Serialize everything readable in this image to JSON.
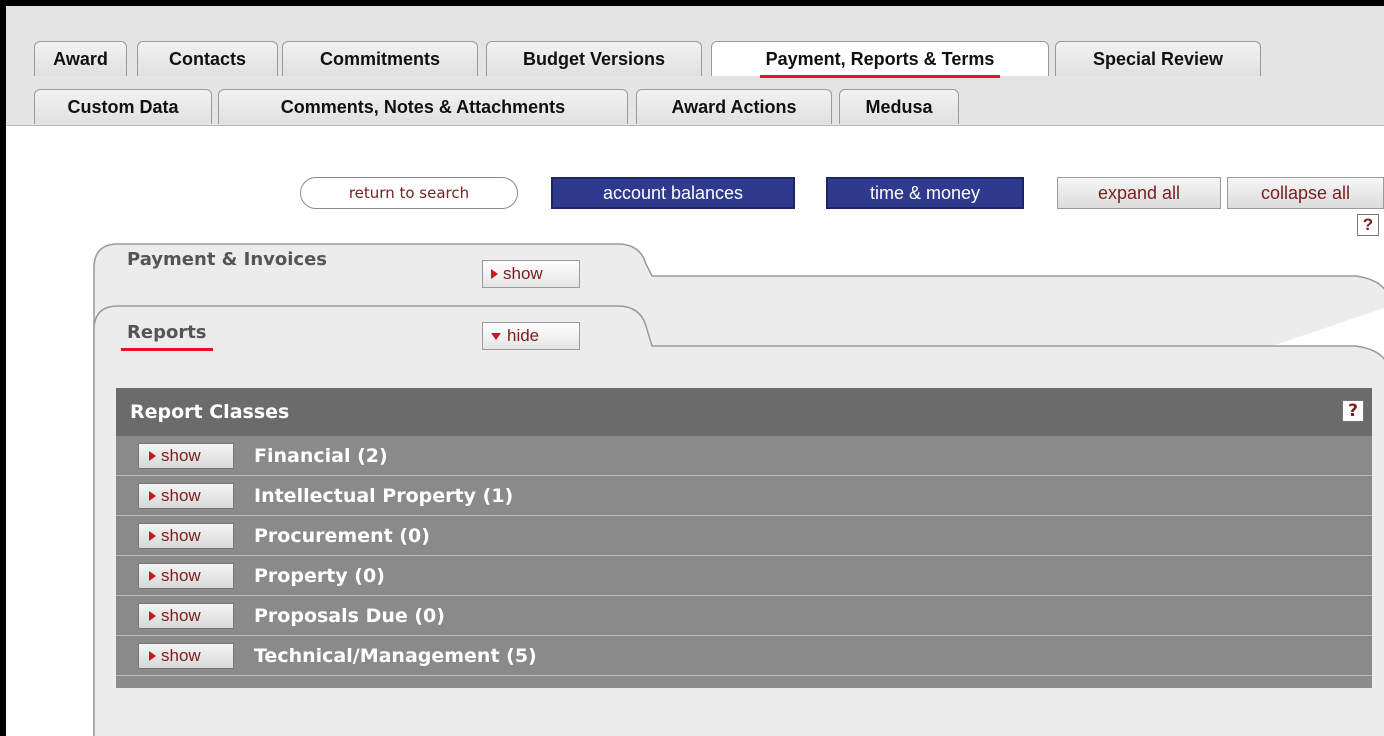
{
  "tabs_row1": [
    "Award",
    "Contacts",
    "Commitments",
    "Budget Versions",
    "Payment, Reports & Terms",
    "Special Review"
  ],
  "tabs_row2": [
    "Custom Data",
    "Comments, Notes & Attachments",
    "Award Actions",
    "Medusa"
  ],
  "active_tab": "Payment, Reports & Terms",
  "actions": {
    "return_to_search": "return to search",
    "account_balances": "account balances",
    "time_and_money": "time & money",
    "expand_all": "expand all",
    "collapse_all": "collapse all",
    "help": "?"
  },
  "panels": {
    "payment": {
      "title": "Payment & Invoices",
      "toggle": "show"
    },
    "reports": {
      "title": "Reports",
      "toggle": "hide"
    }
  },
  "report_classes": {
    "header": "Report Classes",
    "help": "?",
    "rows": [
      {
        "toggle": "show",
        "label": "Financial (2)"
      },
      {
        "toggle": "show",
        "label": "Intellectual Property (1)"
      },
      {
        "toggle": "show",
        "label": "Procurement (0)"
      },
      {
        "toggle": "show",
        "label": "Property (0)"
      },
      {
        "toggle": "show",
        "label": "Proposals Due (0)"
      },
      {
        "toggle": "show",
        "label": "Technical/Management (5)"
      }
    ]
  },
  "colors": {
    "accent_underline": "#e8121f",
    "blue_button": "#2f3a8f",
    "report_header": "#6b6b6b",
    "report_rows": "#8a8a8a"
  }
}
